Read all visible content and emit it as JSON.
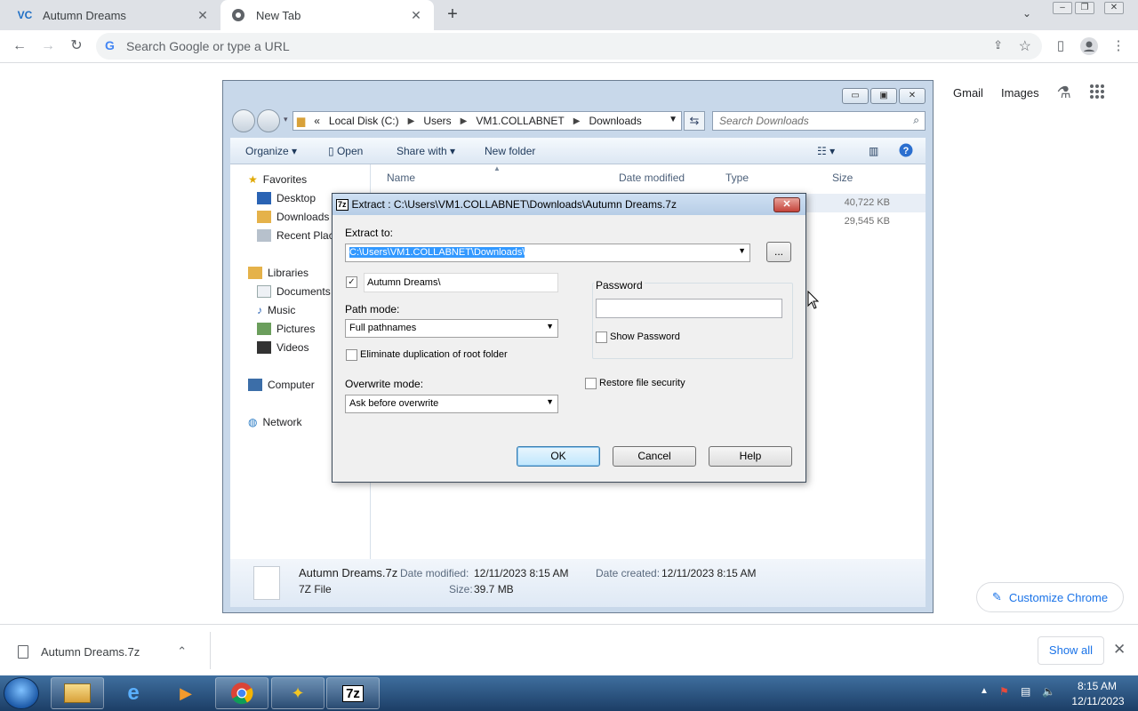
{
  "browser": {
    "tabs": [
      {
        "title": "Autumn Dreams",
        "favicon": "vc-logo-icon"
      },
      {
        "title": "New Tab",
        "favicon": "chrome-icon"
      }
    ],
    "omnibox_placeholder": "Search Google or type a URL",
    "ntp_links": [
      "Gmail",
      "Images"
    ],
    "customize_label": "Customize Chrome"
  },
  "explorer": {
    "breadcrumb": [
      "Local Disk (C:)",
      "Users",
      "VM1.COLLABNET",
      "Downloads"
    ],
    "breadcrumb_lead": "«",
    "search_placeholder": "Search Downloads",
    "commands": {
      "organize": "Organize",
      "open": "Open",
      "share": "Share with",
      "new_folder": "New folder"
    },
    "nav": {
      "favorites": "Favorites",
      "desktop": "Desktop",
      "downloads": "Downloads",
      "recent": "Recent Places",
      "libraries": "Libraries",
      "documents": "Documents",
      "music": "Music",
      "pictures": "Pictures",
      "videos": "Videos",
      "computer": "Computer",
      "network": "Network"
    },
    "columns": [
      "Name",
      "Date modified",
      "Type",
      "Size"
    ],
    "sizes": [
      "40,722 KB",
      "29,545 KB"
    ],
    "details": {
      "filename": "Autumn Dreams.7z",
      "filetype": "7Z File",
      "modified_label": "Date modified:",
      "modified_value": "12/11/2023 8:15 AM",
      "created_label": "Date created:",
      "created_value": "12/11/2023 8:15 AM",
      "size_label": "Size:",
      "size_value": "39.7 MB"
    }
  },
  "dialog": {
    "title": "Extract : C:\\Users\\VM1.COLLABNET\\Downloads\\Autumn Dreams.7z",
    "extract_to_label": "Extract to:",
    "extract_to_value": "C:\\Users\\VM1.COLLABNET\\Downloads\\",
    "browse_label": "...",
    "subfolder_value": "Autumn Dreams\\",
    "subfolder_checked": true,
    "path_mode_label": "Path mode:",
    "path_mode_value": "Full pathnames",
    "eliminate_label": "Eliminate duplication of root folder",
    "overwrite_label": "Overwrite mode:",
    "overwrite_value": "Ask before overwrite",
    "password_label": "Password",
    "show_password_label": "Show Password",
    "restore_security_label": "Restore file security",
    "ok_label": "OK",
    "cancel_label": "Cancel",
    "help_label": "Help"
  },
  "download_bar": {
    "filename": "Autumn Dreams.7z",
    "show_all": "Show all"
  },
  "taskbar": {
    "time": "8:15 AM",
    "date": "12/11/2023"
  }
}
